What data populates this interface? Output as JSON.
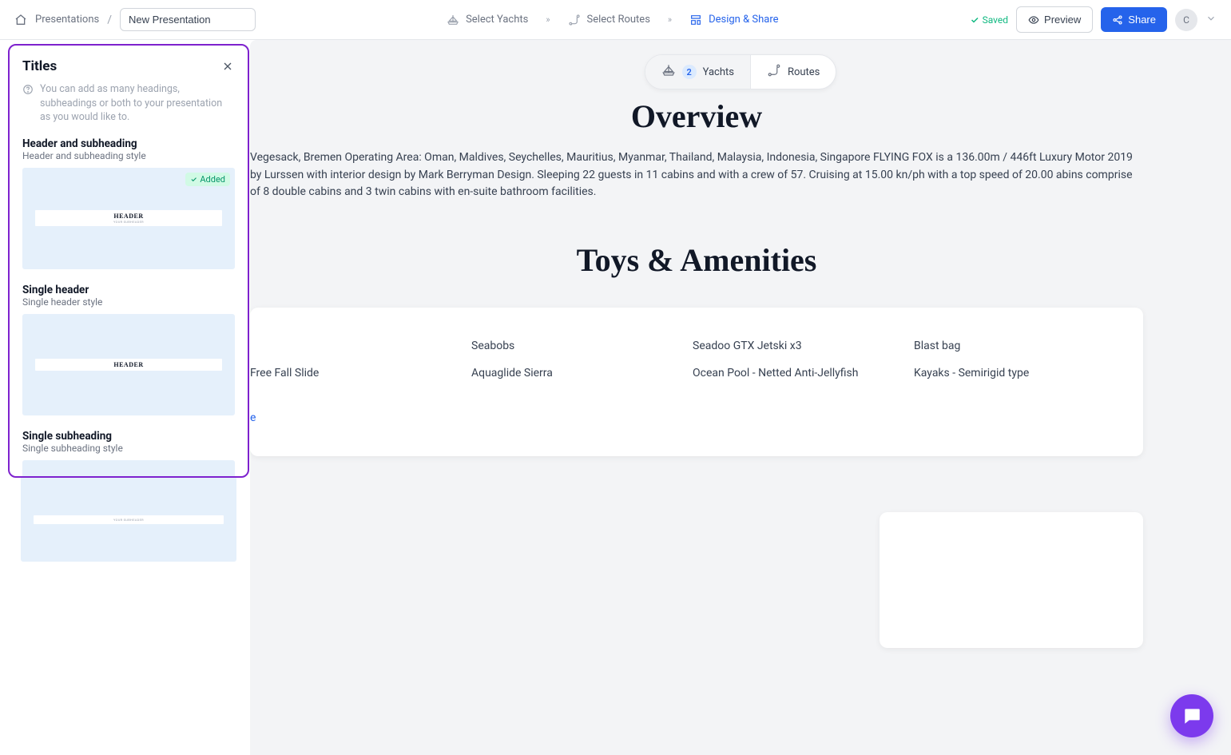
{
  "header": {
    "breadcrumb_root": "Presentations",
    "title_value": "New Presentation",
    "steps": {
      "yachts": "Select Yachts",
      "routes": "Select Routes",
      "design": "Design & Share"
    },
    "saved_label": "Saved",
    "preview_label": "Preview",
    "share_label": "Share",
    "avatar_initial": "C"
  },
  "pill": {
    "yachts_count": "2",
    "yachts_label": "Yachts",
    "routes_label": "Routes"
  },
  "content": {
    "overview_title": "Overview",
    "overview_text": "Vegesack, Bremen Operating Area: Oman, Maldives, Seychelles, Mauritius, Myanmar, Thailand, Malaysia, Indonesia, Singapore FLYING FOX is a 136.00m / 446ft Luxury Motor 2019 by Lurssen with interior design by Mark Berryman Design. Sleeping 22 guests in 11 cabins and with a crew of 57. Cruising at 15.00 kn/ph with a top speed of 20.00 abins comprise of 8 double cabins and 3 twin cabins with en-suite bathroom facilities.",
    "toys_title": "Toys & Amenities",
    "toys_grid": [
      [
        "",
        "Seabobs",
        "Seadoo GTX Jetski x3",
        "Blast bag"
      ],
      [
        "Free Fall Slide",
        "Aquaglide Sierra",
        "Ocean Pool - Netted Anti-Jellyfish",
        "Kayaks - Semirigid type"
      ]
    ],
    "show_more": "e"
  },
  "panel": {
    "title": "Titles",
    "info_text": "You can add as many headings, subheadings or both to your presentation as you would like to.",
    "added_label": "Added",
    "layouts": [
      {
        "name": "Header and subheading",
        "sub": "Header and subheading style",
        "preview_header": "HEADER",
        "preview_sub": "YOUR SUBHEADER"
      },
      {
        "name": "Single header",
        "sub": "Single header style",
        "preview_header": "HEADER",
        "preview_sub": ""
      },
      {
        "name": "Single subheading",
        "sub": "Single subheading style",
        "preview_header": "",
        "preview_sub": "YOUR SUBHEADER"
      }
    ]
  }
}
